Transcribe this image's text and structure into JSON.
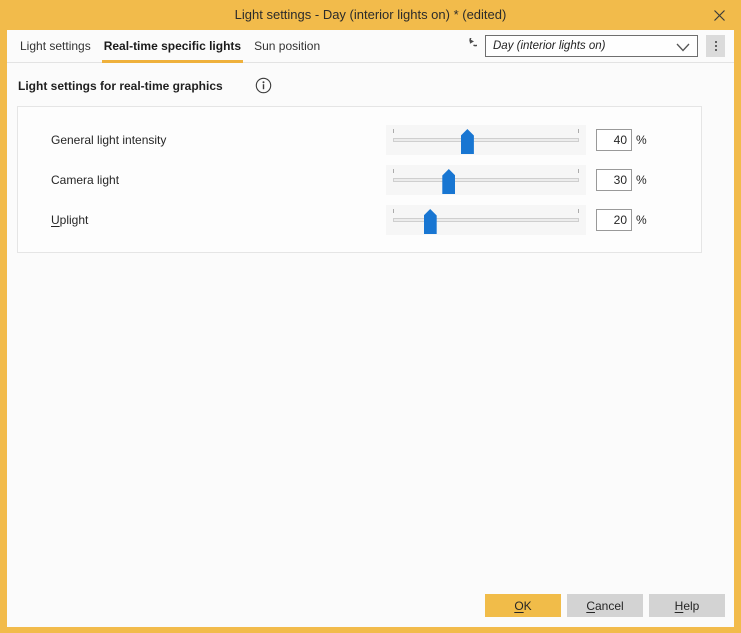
{
  "window": {
    "title": "Light settings - Day (interior lights on) * (edited)"
  },
  "colors": {
    "accent_yellow": "#F2BB4B",
    "tab_underline_yellow": "#EFB13C",
    "slider_thumb_blue": "#1876D2",
    "button_gray": "#D3D3D3"
  },
  "icons": {
    "close": "x-cross",
    "refresh": "circular-arrow",
    "info": "i-in-circle",
    "chevron_down": "v",
    "kebab": "vertical-3-dots"
  },
  "tabs": [
    {
      "label": "Light settings",
      "active": false
    },
    {
      "label": "Real-time specific lights",
      "active": true
    },
    {
      "label": "Sun position",
      "active": false
    }
  ],
  "toolbar": {
    "preset_dropdown_value": "Day (interior lights on)"
  },
  "section": {
    "heading": "Light settings for real-time graphics"
  },
  "sliders": [
    {
      "label": "General light intensity",
      "value": 40,
      "unit": "%"
    },
    {
      "label": "Camera light",
      "value": 30,
      "unit": "%"
    },
    {
      "label_mn": "U",
      "label_rest": "plight",
      "value": 20,
      "unit": "%"
    }
  ],
  "footer": {
    "ok_mn": "O",
    "ok_rest": "K",
    "cancel_mn": "C",
    "cancel_rest": "ancel",
    "help_mn": "H",
    "help_rest": "elp"
  }
}
